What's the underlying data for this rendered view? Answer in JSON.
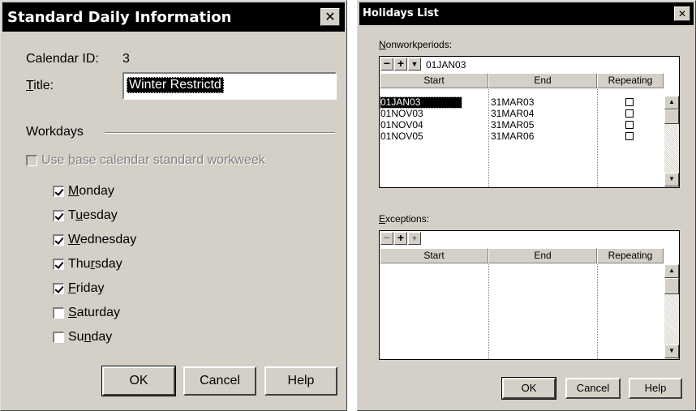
{
  "left_dialog": {
    "title": "Standard Daily Information",
    "close_glyph": "✕",
    "calendar_id_label": "Calendar ID:",
    "calendar_id_value": "3",
    "title_label_pre": "",
    "title_label_u": "T",
    "title_label_post": "itle:",
    "title_value": "Winter Restrictd",
    "workdays_label": "Workdays",
    "use_base": {
      "pre": "Use ",
      "u": "b",
      "post": "ase calendar standard workweek",
      "checked": false,
      "enabled": false
    },
    "days": [
      {
        "pre": "",
        "u": "M",
        "post": "onday",
        "checked": true
      },
      {
        "pre": "T",
        "u": "u",
        "post": "esday",
        "checked": true
      },
      {
        "pre": "",
        "u": "W",
        "post": "ednesday",
        "checked": true
      },
      {
        "pre": "Thu",
        "u": "r",
        "post": "sday",
        "checked": true
      },
      {
        "pre": "",
        "u": "F",
        "post": "riday",
        "checked": true
      },
      {
        "pre": "",
        "u": "S",
        "post": "aturday",
        "checked": false
      },
      {
        "pre": "Su",
        "u": "n",
        "post": "day",
        "checked": false
      }
    ],
    "buttons": {
      "ok": "OK",
      "cancel": "Cancel",
      "help": "Help"
    }
  },
  "right_dialog": {
    "title": "Holidays List",
    "close_glyph": "✕",
    "nonwork_label_u": "N",
    "nonwork_label_post": "onworkperiods:",
    "nonwork_current": "01JAN03",
    "columns": [
      "Start",
      "End",
      "Repeating"
    ],
    "nonwork_rows": [
      {
        "start": "01JAN03",
        "end": "31MAR03",
        "repeating": false
      },
      {
        "start": "01NOV03",
        "end": "31MAR04",
        "repeating": false
      },
      {
        "start": "01NOV04",
        "end": "31MAR05",
        "repeating": false
      },
      {
        "start": "01NOV05",
        "end": "31MAR06",
        "repeating": false
      }
    ],
    "exceptions_label_u": "E",
    "exceptions_label_post": "xceptions:",
    "toolbar": {
      "minus": "−",
      "plus": "+",
      "dropdown": "▼"
    },
    "scroll": {
      "up": "▲",
      "down": "▼"
    },
    "buttons": {
      "ok": "OK",
      "cancel": "Cancel",
      "help": "Help"
    }
  }
}
